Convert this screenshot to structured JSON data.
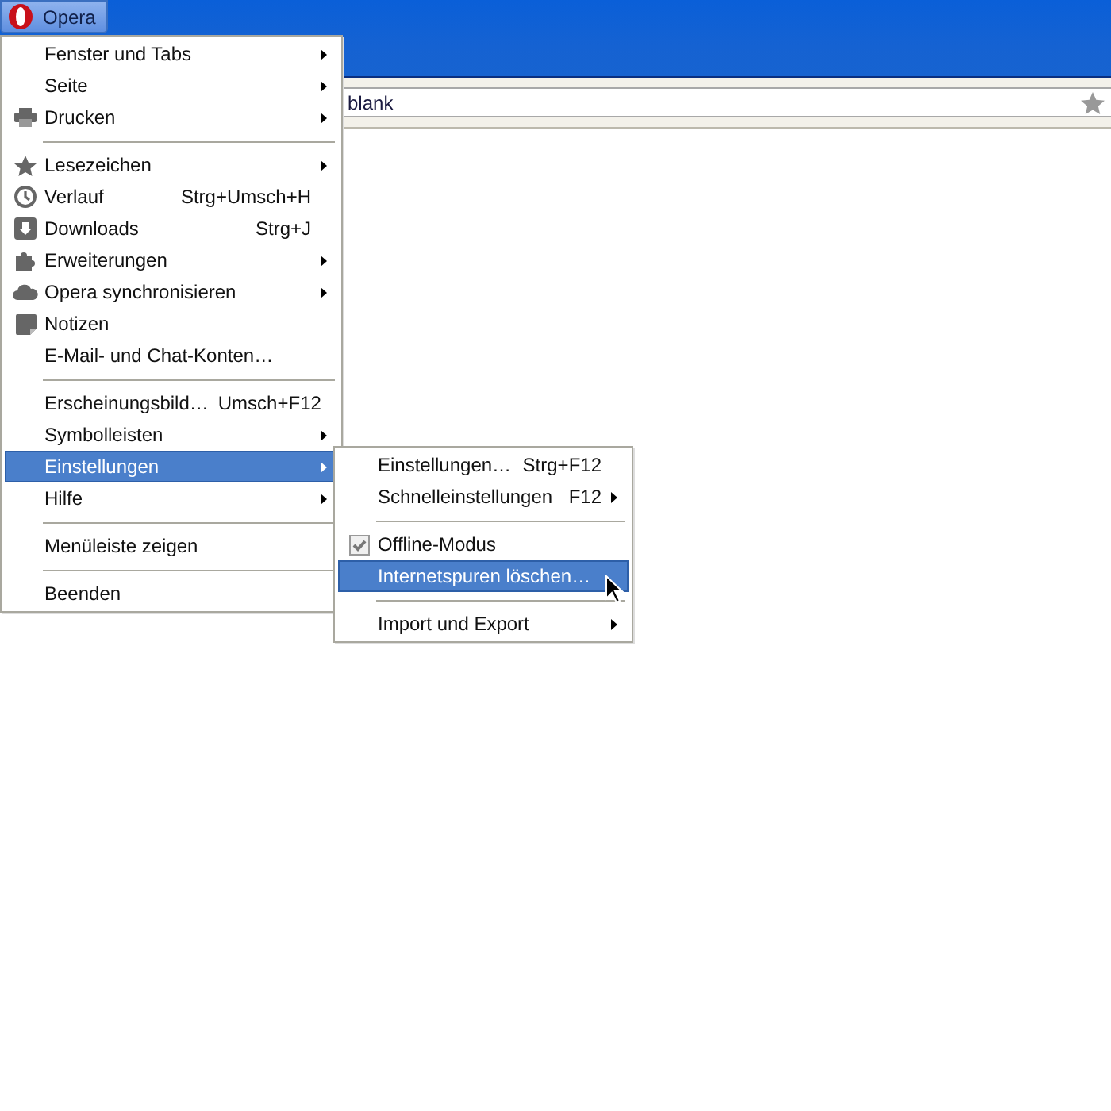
{
  "menu_button": {
    "label": "Opera"
  },
  "address": {
    "value": "blank"
  },
  "menu": [
    {
      "kind": "item",
      "label": "Fenster und Tabs",
      "submenu": true,
      "selected": false
    },
    {
      "kind": "item",
      "label": "Seite",
      "submenu": true,
      "selected": false
    },
    {
      "kind": "item",
      "label": "Drucken",
      "submenu": true,
      "selected": false
    },
    {
      "kind": "separator"
    },
    {
      "kind": "item",
      "label": "Lesezeichen",
      "submenu": true,
      "selected": false
    },
    {
      "kind": "item",
      "label": "Verlauf",
      "shortcut": "Strg+Umsch+H",
      "submenu": false,
      "selected": false
    },
    {
      "kind": "item",
      "label": "Downloads",
      "shortcut": "Strg+J",
      "submenu": false,
      "selected": false
    },
    {
      "kind": "item",
      "label": "Erweiterungen",
      "submenu": true,
      "selected": false
    },
    {
      "kind": "item",
      "label": "Opera synchronisieren",
      "submenu": true,
      "selected": false
    },
    {
      "kind": "item",
      "label": "Notizen",
      "submenu": false,
      "selected": false
    },
    {
      "kind": "item",
      "label": "E-Mail- und Chat-Konten…",
      "submenu": false,
      "selected": false
    },
    {
      "kind": "separator"
    },
    {
      "kind": "item",
      "label": "Erscheinungsbild…",
      "shortcut": "Umsch+F12",
      "submenu": false,
      "selected": false
    },
    {
      "kind": "item",
      "label": "Symbolleisten",
      "submenu": true,
      "selected": false
    },
    {
      "kind": "item",
      "label": "Einstellungen",
      "submenu": true,
      "selected": true
    },
    {
      "kind": "item",
      "label": "Hilfe",
      "submenu": true,
      "selected": false
    },
    {
      "kind": "separator"
    },
    {
      "kind": "item",
      "label": "Menüleiste zeigen",
      "submenu": false,
      "selected": false
    },
    {
      "kind": "separator"
    },
    {
      "kind": "item",
      "label": "Beenden",
      "submenu": false,
      "selected": false
    }
  ],
  "submenu": [
    {
      "kind": "item",
      "label": "Einstellungen…",
      "shortcut": "Strg+F12",
      "submenu": false,
      "selected": false
    },
    {
      "kind": "item",
      "label": "Schnelleinstellungen",
      "shortcut": "F12",
      "submenu": true,
      "selected": false
    },
    {
      "kind": "separator"
    },
    {
      "kind": "check",
      "label": "Offline-Modus",
      "checked": true,
      "submenu": false,
      "selected": false
    },
    {
      "kind": "item",
      "label": "Internetspuren löschen…",
      "submenu": false,
      "selected": true
    },
    {
      "kind": "separator"
    },
    {
      "kind": "item",
      "label": "Import und Export",
      "submenu": true,
      "selected": false
    }
  ]
}
